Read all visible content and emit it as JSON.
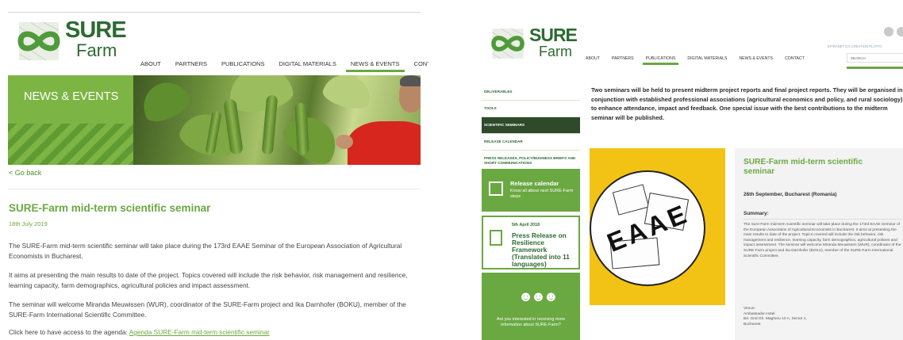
{
  "left": {
    "logo": {
      "sure": "SURE",
      "farm": "Farm"
    },
    "nav": [
      "ABOUT",
      "PARTNERS",
      "PUBLICATIONS",
      "DIGITAL MATERIALS",
      "NEWS & EVENTS",
      "CONT"
    ],
    "banner_title": "NEWS & EVENTS",
    "back_link": "< Go back",
    "title": "SURE-Farm mid-term scientific seminar",
    "date": "18th July 2019",
    "p1": "The SURE-Farm mid-term scientific seminar will take place during the 173rd EAAE Seminar of the European Association of Agricultural Economists in Bucharest.",
    "p2": "It aims at presenting the main results to date of the project. Topics covered will include the risk behavior, risk management and resilience, learning capacity, farm demographics, agricultural policies and impact assessment.",
    "p3": "The seminar will welcome Miranda Meuwissen (WUR), coordinator of the SURE-Farm project and Ika Darnhofer (BOKU), member of the SURE-Farm International Scientific Committee.",
    "p4_text": "Click here to have access to the agenda:",
    "p4_link": "Agenda SURE-Farm mid-term scientific seminar"
  },
  "right": {
    "logo": {
      "sure": "SURE",
      "farm": "Farm"
    },
    "nav": [
      "ABOUT",
      "PARTNERS",
      "PUBLICATIONS",
      "DIGITAL MATERIALS",
      "NEWS & EVENTS",
      "CONTACT"
    ],
    "util_links": "INTRANET  CO-CREATION PLATFO",
    "search_placeholder": "SEARCH",
    "sidenav": [
      "DELIVERABLES",
      "TOOLS",
      "SCIENTIFIC SEMINARS",
      "RELEASE CALENDAR",
      "PRESS RELEASES, POLICY/BUSINESS BRIEFS AND SHORT COMMUNICATIONS"
    ],
    "card_release": {
      "title": "Release calendar",
      "subtitle": "Know all about next SURE-Farm steps"
    },
    "card_press": {
      "date": "5th April 2018",
      "title": "Press Release on Resilience Framework (Translated into 11 languages)"
    },
    "card_info": {
      "text": "Are you interested in receiving more information about SURE-Farm?"
    },
    "intro": "Two seminars will be held to present midterm project reports and final project reports. They will be organised in conjunction with established professional associations (agricultural economics and policy, and rural sociology) to enhance attendance, impact and feedback. One special issue with the best contributions to the midterm seminar will be published.",
    "image_label": "EAAE",
    "detail": {
      "title": "SURE-Farm mid-term scientific seminar",
      "when": "26th September, Bucharest (Romania)",
      "summary_heading": "Summary:",
      "summary": "The Sure-Farm mid-term scientific seminar will take place during the 173rd EAAE Seminar of the European Association of Agricultural Economists in Bucharest. It aims at presenting the main results to date of the project. Topics covered will include the risk behavior, risk management and resilience, learning capacity, farm demographics, agricultural policies and impact assessment. The seminar will welcome Miranda Meuwissen (WUR), coordinator of the SURE-Farm project and Ika Darnhofer (BOKU), member of the SURE-Farm International Scientific Committee.",
      "venue_label": "Venue:",
      "venue_name": "Ambassador Hotel",
      "venue_address": "Bd. Gral Gh. Magheru 10 A, Sector 1,",
      "venue_city": "Bucharest"
    }
  }
}
